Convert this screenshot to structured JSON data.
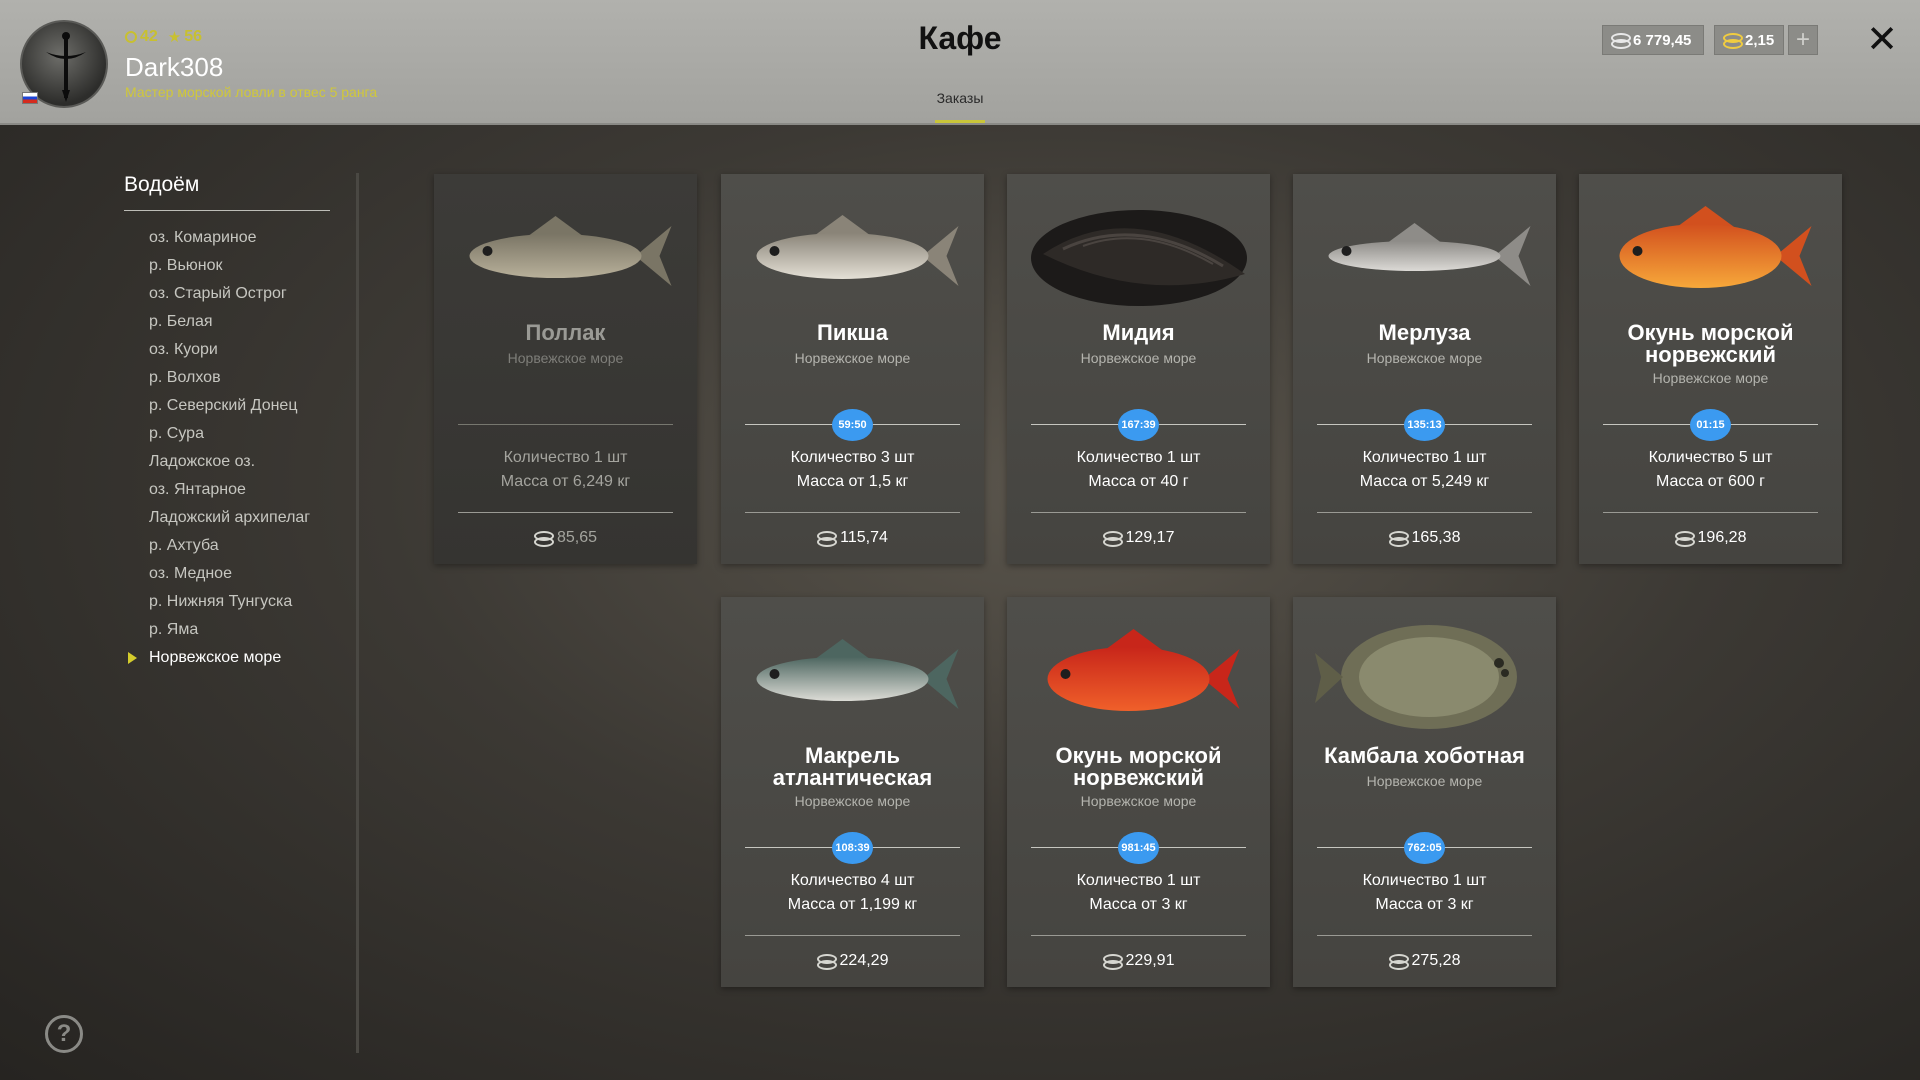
{
  "header": {
    "stats": {
      "level": "42",
      "stars": "56"
    },
    "username": "Dark308",
    "rank": "Мастер морской ловли в отвес 5 ранга",
    "title": "Кафе",
    "tab": "Заказы",
    "silver": "6 779,45",
    "gold": "2,15",
    "plus_label": "+",
    "close_label": "✕",
    "icons": [
      "dagger-avatar-icon",
      "russia-flag-icon",
      "ring-icon",
      "star-icon",
      "silver-coins-icon",
      "gold-coins-icon",
      "plus-icon",
      "close-icon"
    ],
    "colors": {
      "accent": "#c9c53a",
      "timer": "#3b9af0"
    }
  },
  "sidebar": {
    "title": "Водоём",
    "items": [
      "оз. Комариное",
      "р. Вьюнок",
      "оз. Старый Острог",
      "р. Белая",
      "оз. Куори",
      "р. Волхов",
      "р. Северский Донец",
      "р. Сура",
      "Ладожское оз.",
      "оз. Янтарное",
      "Ладожский архипелаг",
      "р. Ахтуба",
      "оз. Медное",
      "р. Нижняя Тунгуска",
      "р. Яма",
      "Норвежское море"
    ],
    "active_index": 15,
    "help_label": "?"
  },
  "cards": [
    {
      "name": "Поллак",
      "location": "Норвежское море",
      "timer": "",
      "quantity": "Количество 1 шт",
      "mass": "Масса от 6,249 кг",
      "price": "85,65",
      "image": "pollack-fish-icon",
      "available": false
    },
    {
      "name": "Пикша",
      "location": "Норвежское море",
      "timer": "59:50",
      "quantity": "Количество 3 шт",
      "mass": "Масса от 1,5 кг",
      "price": "115,74",
      "image": "haddock-fish-icon",
      "available": true
    },
    {
      "name": "Мидия",
      "location": "Норвежское море",
      "timer": "167:39",
      "quantity": "Количество 1 шт",
      "mass": "Масса от 40 г",
      "price": "129,17",
      "image": "mussel-icon",
      "available": true
    },
    {
      "name": "Мерлуза",
      "location": "Норвежское море",
      "timer": "135:13",
      "quantity": "Количество 1 шт",
      "mass": "Масса от 5,249 кг",
      "price": "165,38",
      "image": "hake-fish-icon",
      "available": true
    },
    {
      "name": "Окунь морской норвежский",
      "location": "Норвежское море",
      "timer": "01:15",
      "quantity": "Количество 5 шт",
      "mass": "Масса от 600 г",
      "price": "196,28",
      "image": "redfish-icon",
      "available": true
    },
    {
      "name": "Макрель атлантическая",
      "location": "Норвежское море",
      "timer": "108:39",
      "quantity": "Количество 4 шт",
      "mass": "Масса от 1,199 кг",
      "price": "224,29",
      "image": "mackerel-fish-icon",
      "available": true
    },
    {
      "name": "Окунь морской норвежский",
      "location": "Норвежское море",
      "timer": "981:45",
      "quantity": "Количество 1 шт",
      "mass": "Масса от 3 кг",
      "price": "229,91",
      "image": "red-rosefish-icon",
      "available": true
    },
    {
      "name": "Камбала хоботная",
      "location": "Норвежское море",
      "timer": "762:05",
      "quantity": "Количество 1 шт",
      "mass": "Масса от 3 кг",
      "price": "275,28",
      "image": "flounder-fish-icon",
      "available": true
    }
  ]
}
